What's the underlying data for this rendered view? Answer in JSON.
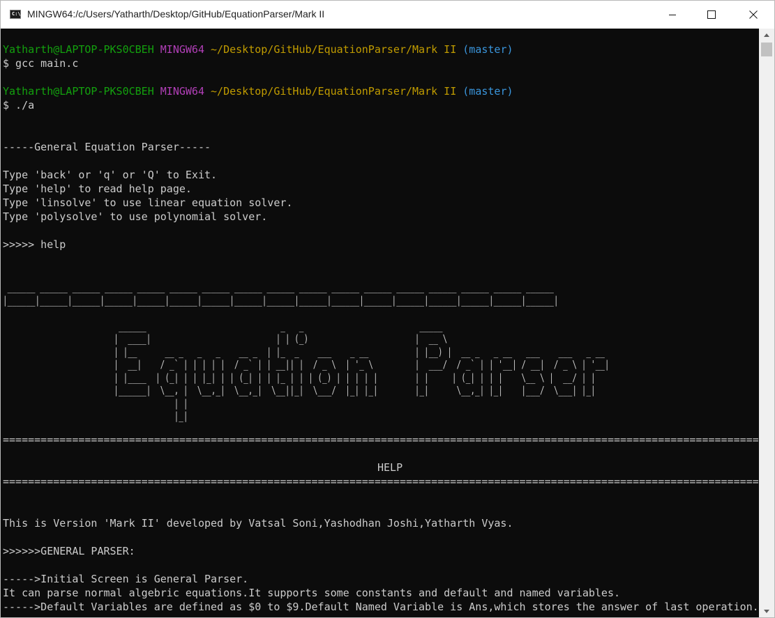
{
  "window": {
    "title": "MINGW64:/c/Users/Yatharth/Desktop/GitHub/EquationParser/Mark II",
    "app_icon_text": "C:\\"
  },
  "prompts": [
    {
      "user": "Yatharth@LAPTOP-PKS0CBEH",
      "system": "MINGW64",
      "path": "~/Desktop/GitHub/EquationParser/Mark II",
      "branch": "(master)",
      "command": "$ gcc main.c"
    },
    {
      "user": "Yatharth@LAPTOP-PKS0CBEH",
      "system": "MINGW64",
      "path": "~/Desktop/GitHub/EquationParser/Mark II",
      "branch": "(master)",
      "command": "$ ./a"
    }
  ],
  "output": {
    "banner": "-----General Equation Parser-----",
    "instructions": [
      "Type 'back' or 'q' or 'Q' to Exit.",
      "Type 'help' to read help page.",
      "Type 'linsolve' to use linear equation solver.",
      "Type 'polysolve' to use polynomial solver."
    ],
    "input_line": ">>>>> help",
    "ascii_art": " ______ ______ ______ ______ ______ ______ ______ ______ ______ ______ ______ ______ ______ ______ ______ ______ ______\n|______|______|______|______|______|______|______|______|______|______|______|______|______|______|______|______|______|\n\n                         ______                             _   _                         _____\n                        |  ____|                           | | (_)                       |  __ \\\n                        | |__      __ _   _   _    __ _  | |_  _    ___    _ __          | |__) |  __ _   _ __   ___    ___   _ __\n                        |  __|    / _` | | | | |  / _` | | __|| |  / _ \\  | '_ \\         |  ___/  / _` | | '__| / __|  / _ \\ | '__|\n                        | |____  | (_| | | |_| | | (_| | | |_ | | | (_) | | | | |        | |     | (_| | | |    \\__ \\ |  __/ | |\n                        |______|  \\__, |  \\__,_|  \\__,_|  \\__||_|  \\___/  |_| |_|        |_|      \\__,_| |_|    |___/  \\___| |_|\n                                     | |\n                                     |_|",
    "separator": "========================================================================================================================",
    "help_title": "HELP",
    "version_text": "This is Version 'Mark II' developed by Vatsal Soni,Yashodhan Joshi,Yatharth Vyas.",
    "section_heading": ">>>>>>GENERAL PARSER:",
    "help_lines": [
      "----->Initial Screen is General Parser.",
      "It can parse normal algebric equations.It supports some constants and default and named variables.",
      "----->Default Variables are defined as $0 to $9.Default Named Variable is Ans,which stores the answer of last operation."
    ]
  }
}
